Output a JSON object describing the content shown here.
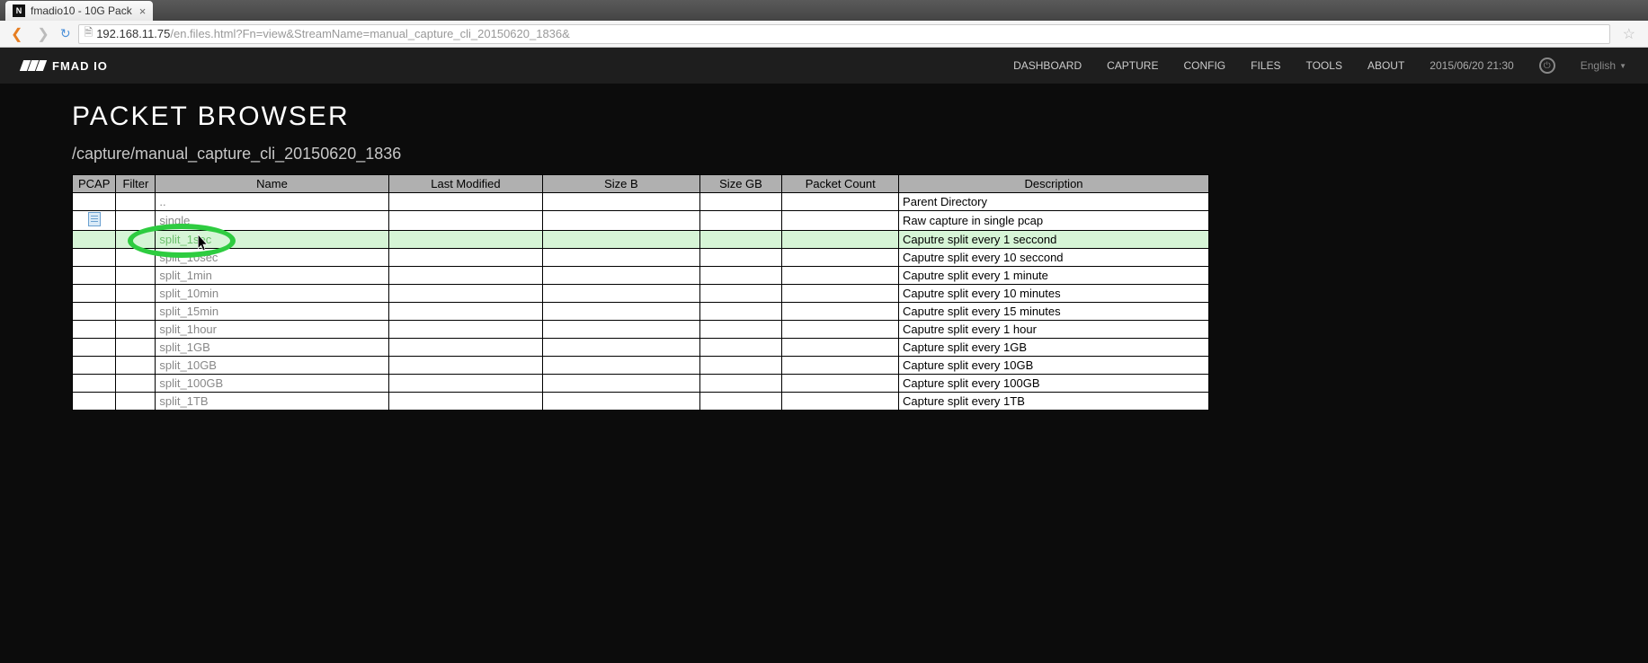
{
  "browser": {
    "tab_title": "fmadio10 - 10G Pack",
    "url_host": "192.168.11.75",
    "url_path": "/en.files.html?Fn=view&StreamName=manual_capture_cli_20150620_1836&"
  },
  "header": {
    "brand": "FMAD IO",
    "nav": [
      "DASHBOARD",
      "CAPTURE",
      "CONFIG",
      "FILES",
      "TOOLS",
      "ABOUT"
    ],
    "timestamp": "2015/06/20 21:30",
    "language": "English"
  },
  "page": {
    "title": "PACKET BROWSER",
    "breadcrumb": "/capture/manual_capture_cli_20150620_1836"
  },
  "table": {
    "headers": [
      "PCAP",
      "Filter",
      "Name",
      "Last Modified",
      "Size B",
      "Size GB",
      "Packet Count",
      "Description"
    ],
    "rows": [
      {
        "name": "..",
        "desc": "Parent Directory",
        "icon": false,
        "hover": false
      },
      {
        "name": "single",
        "desc": "Raw capture in single pcap",
        "icon": true,
        "hover": false
      },
      {
        "name": "split_1sec",
        "desc": "Caputre split every 1 seccond",
        "icon": false,
        "hover": true
      },
      {
        "name": "split_10sec",
        "desc": "Caputre split every 10 seccond",
        "icon": false,
        "hover": false
      },
      {
        "name": "split_1min",
        "desc": "Caputre split every 1 minute",
        "icon": false,
        "hover": false
      },
      {
        "name": "split_10min",
        "desc": "Caputre split every 10 minutes",
        "icon": false,
        "hover": false
      },
      {
        "name": "split_15min",
        "desc": "Caputre split every 15 minutes",
        "icon": false,
        "hover": false
      },
      {
        "name": "split_1hour",
        "desc": "Caputre split every 1 hour",
        "icon": false,
        "hover": false
      },
      {
        "name": "split_1GB",
        "desc": "Capture split every 1GB",
        "icon": false,
        "hover": false
      },
      {
        "name": "split_10GB",
        "desc": "Capture split every 10GB",
        "icon": false,
        "hover": false
      },
      {
        "name": "split_100GB",
        "desc": "Capture split every 100GB",
        "icon": false,
        "hover": false
      },
      {
        "name": "split_1TB",
        "desc": "Capture split every 1TB",
        "icon": false,
        "hover": false
      }
    ]
  }
}
